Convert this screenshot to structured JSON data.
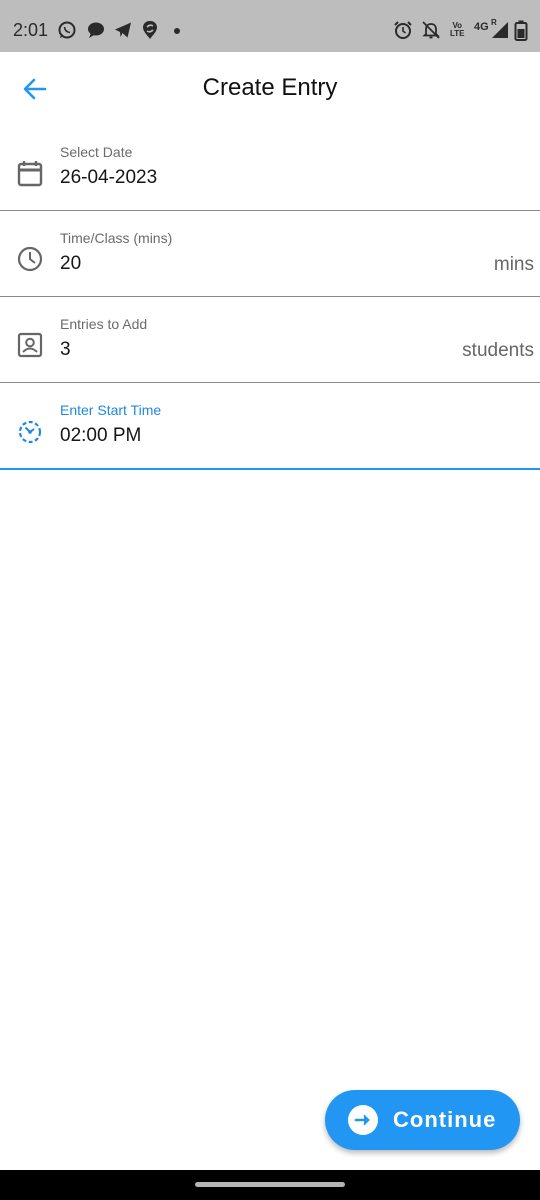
{
  "status_bar": {
    "time": "2:01",
    "notification_icons": [
      "whatsapp-icon",
      "chat-bubble-icon",
      "telegram-icon",
      "swiggy-icon"
    ],
    "system_icons": [
      "alarm-icon",
      "bell-off-icon",
      "volte-icon",
      "signal-icon",
      "battery-icon"
    ],
    "volte_line1": "Vo",
    "volte_line2": "LTE",
    "network": "4G",
    "roaming": "R"
  },
  "app_bar": {
    "title": "Create Entry",
    "back_icon": "arrow-back-icon"
  },
  "form": {
    "fields": [
      {
        "label": "Select Date",
        "value": "26-04-2023",
        "suffix": "",
        "icon": "calendar-icon"
      },
      {
        "label": "Time/Class (mins)",
        "value": "20",
        "suffix": "mins",
        "icon": "clock-icon"
      },
      {
        "label": "Entries to Add",
        "value": "3",
        "suffix": "students",
        "icon": "person-box-icon"
      },
      {
        "label": "Enter Start Time",
        "value": "02:00 PM",
        "suffix": "",
        "icon": "timer-icon",
        "focused": true
      }
    ]
  },
  "fab": {
    "label": "Continue",
    "icon": "arrow-forward-circle-icon"
  },
  "colors": {
    "accent": "#2196f3",
    "status_bar": "#bdbdbd",
    "divider": "#8a8a8a"
  }
}
